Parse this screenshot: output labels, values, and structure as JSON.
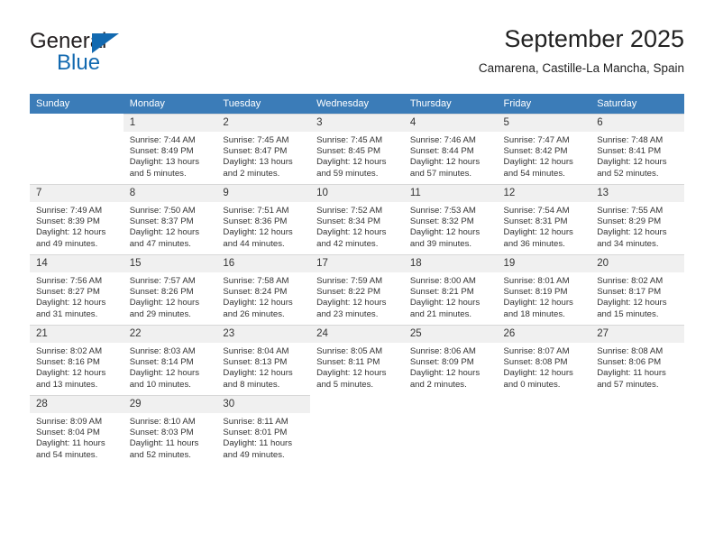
{
  "brand": {
    "name_top": "General",
    "name_bottom": "Blue",
    "accent_color": "#1269b0"
  },
  "header": {
    "title": "September 2025",
    "subtitle": "Camarena, Castille-La Mancha, Spain"
  },
  "theme": {
    "header_row_background": "#3b7cb8",
    "header_row_text": "#ffffff",
    "day_number_background": "#f0f0f0",
    "grid_line": "#d8d8d8"
  },
  "weekdays": [
    "Sunday",
    "Monday",
    "Tuesday",
    "Wednesday",
    "Thursday",
    "Friday",
    "Saturday"
  ],
  "weeks": [
    [
      {
        "empty": true
      },
      {
        "day": "1",
        "sunrise": "Sunrise: 7:44 AM",
        "sunset": "Sunset: 8:49 PM",
        "daylight1": "Daylight: 13 hours",
        "daylight2": "and 5 minutes."
      },
      {
        "day": "2",
        "sunrise": "Sunrise: 7:45 AM",
        "sunset": "Sunset: 8:47 PM",
        "daylight1": "Daylight: 13 hours",
        "daylight2": "and 2 minutes."
      },
      {
        "day": "3",
        "sunrise": "Sunrise: 7:45 AM",
        "sunset": "Sunset: 8:45 PM",
        "daylight1": "Daylight: 12 hours",
        "daylight2": "and 59 minutes."
      },
      {
        "day": "4",
        "sunrise": "Sunrise: 7:46 AM",
        "sunset": "Sunset: 8:44 PM",
        "daylight1": "Daylight: 12 hours",
        "daylight2": "and 57 minutes."
      },
      {
        "day": "5",
        "sunrise": "Sunrise: 7:47 AM",
        "sunset": "Sunset: 8:42 PM",
        "daylight1": "Daylight: 12 hours",
        "daylight2": "and 54 minutes."
      },
      {
        "day": "6",
        "sunrise": "Sunrise: 7:48 AM",
        "sunset": "Sunset: 8:41 PM",
        "daylight1": "Daylight: 12 hours",
        "daylight2": "and 52 minutes."
      }
    ],
    [
      {
        "day": "7",
        "sunrise": "Sunrise: 7:49 AM",
        "sunset": "Sunset: 8:39 PM",
        "daylight1": "Daylight: 12 hours",
        "daylight2": "and 49 minutes."
      },
      {
        "day": "8",
        "sunrise": "Sunrise: 7:50 AM",
        "sunset": "Sunset: 8:37 PM",
        "daylight1": "Daylight: 12 hours",
        "daylight2": "and 47 minutes."
      },
      {
        "day": "9",
        "sunrise": "Sunrise: 7:51 AM",
        "sunset": "Sunset: 8:36 PM",
        "daylight1": "Daylight: 12 hours",
        "daylight2": "and 44 minutes."
      },
      {
        "day": "10",
        "sunrise": "Sunrise: 7:52 AM",
        "sunset": "Sunset: 8:34 PM",
        "daylight1": "Daylight: 12 hours",
        "daylight2": "and 42 minutes."
      },
      {
        "day": "11",
        "sunrise": "Sunrise: 7:53 AM",
        "sunset": "Sunset: 8:32 PM",
        "daylight1": "Daylight: 12 hours",
        "daylight2": "and 39 minutes."
      },
      {
        "day": "12",
        "sunrise": "Sunrise: 7:54 AM",
        "sunset": "Sunset: 8:31 PM",
        "daylight1": "Daylight: 12 hours",
        "daylight2": "and 36 minutes."
      },
      {
        "day": "13",
        "sunrise": "Sunrise: 7:55 AM",
        "sunset": "Sunset: 8:29 PM",
        "daylight1": "Daylight: 12 hours",
        "daylight2": "and 34 minutes."
      }
    ],
    [
      {
        "day": "14",
        "sunrise": "Sunrise: 7:56 AM",
        "sunset": "Sunset: 8:27 PM",
        "daylight1": "Daylight: 12 hours",
        "daylight2": "and 31 minutes."
      },
      {
        "day": "15",
        "sunrise": "Sunrise: 7:57 AM",
        "sunset": "Sunset: 8:26 PM",
        "daylight1": "Daylight: 12 hours",
        "daylight2": "and 29 minutes."
      },
      {
        "day": "16",
        "sunrise": "Sunrise: 7:58 AM",
        "sunset": "Sunset: 8:24 PM",
        "daylight1": "Daylight: 12 hours",
        "daylight2": "and 26 minutes."
      },
      {
        "day": "17",
        "sunrise": "Sunrise: 7:59 AM",
        "sunset": "Sunset: 8:22 PM",
        "daylight1": "Daylight: 12 hours",
        "daylight2": "and 23 minutes."
      },
      {
        "day": "18",
        "sunrise": "Sunrise: 8:00 AM",
        "sunset": "Sunset: 8:21 PM",
        "daylight1": "Daylight: 12 hours",
        "daylight2": "and 21 minutes."
      },
      {
        "day": "19",
        "sunrise": "Sunrise: 8:01 AM",
        "sunset": "Sunset: 8:19 PM",
        "daylight1": "Daylight: 12 hours",
        "daylight2": "and 18 minutes."
      },
      {
        "day": "20",
        "sunrise": "Sunrise: 8:02 AM",
        "sunset": "Sunset: 8:17 PM",
        "daylight1": "Daylight: 12 hours",
        "daylight2": "and 15 minutes."
      }
    ],
    [
      {
        "day": "21",
        "sunrise": "Sunrise: 8:02 AM",
        "sunset": "Sunset: 8:16 PM",
        "daylight1": "Daylight: 12 hours",
        "daylight2": "and 13 minutes."
      },
      {
        "day": "22",
        "sunrise": "Sunrise: 8:03 AM",
        "sunset": "Sunset: 8:14 PM",
        "daylight1": "Daylight: 12 hours",
        "daylight2": "and 10 minutes."
      },
      {
        "day": "23",
        "sunrise": "Sunrise: 8:04 AM",
        "sunset": "Sunset: 8:13 PM",
        "daylight1": "Daylight: 12 hours",
        "daylight2": "and 8 minutes."
      },
      {
        "day": "24",
        "sunrise": "Sunrise: 8:05 AM",
        "sunset": "Sunset: 8:11 PM",
        "daylight1": "Daylight: 12 hours",
        "daylight2": "and 5 minutes."
      },
      {
        "day": "25",
        "sunrise": "Sunrise: 8:06 AM",
        "sunset": "Sunset: 8:09 PM",
        "daylight1": "Daylight: 12 hours",
        "daylight2": "and 2 minutes."
      },
      {
        "day": "26",
        "sunrise": "Sunrise: 8:07 AM",
        "sunset": "Sunset: 8:08 PM",
        "daylight1": "Daylight: 12 hours",
        "daylight2": "and 0 minutes."
      },
      {
        "day": "27",
        "sunrise": "Sunrise: 8:08 AM",
        "sunset": "Sunset: 8:06 PM",
        "daylight1": "Daylight: 11 hours",
        "daylight2": "and 57 minutes."
      }
    ],
    [
      {
        "day": "28",
        "sunrise": "Sunrise: 8:09 AM",
        "sunset": "Sunset: 8:04 PM",
        "daylight1": "Daylight: 11 hours",
        "daylight2": "and 54 minutes."
      },
      {
        "day": "29",
        "sunrise": "Sunrise: 8:10 AM",
        "sunset": "Sunset: 8:03 PM",
        "daylight1": "Daylight: 11 hours",
        "daylight2": "and 52 minutes."
      },
      {
        "day": "30",
        "sunrise": "Sunrise: 8:11 AM",
        "sunset": "Sunset: 8:01 PM",
        "daylight1": "Daylight: 11 hours",
        "daylight2": "and 49 minutes."
      },
      {
        "empty": true
      },
      {
        "empty": true
      },
      {
        "empty": true
      },
      {
        "empty": true
      }
    ]
  ]
}
